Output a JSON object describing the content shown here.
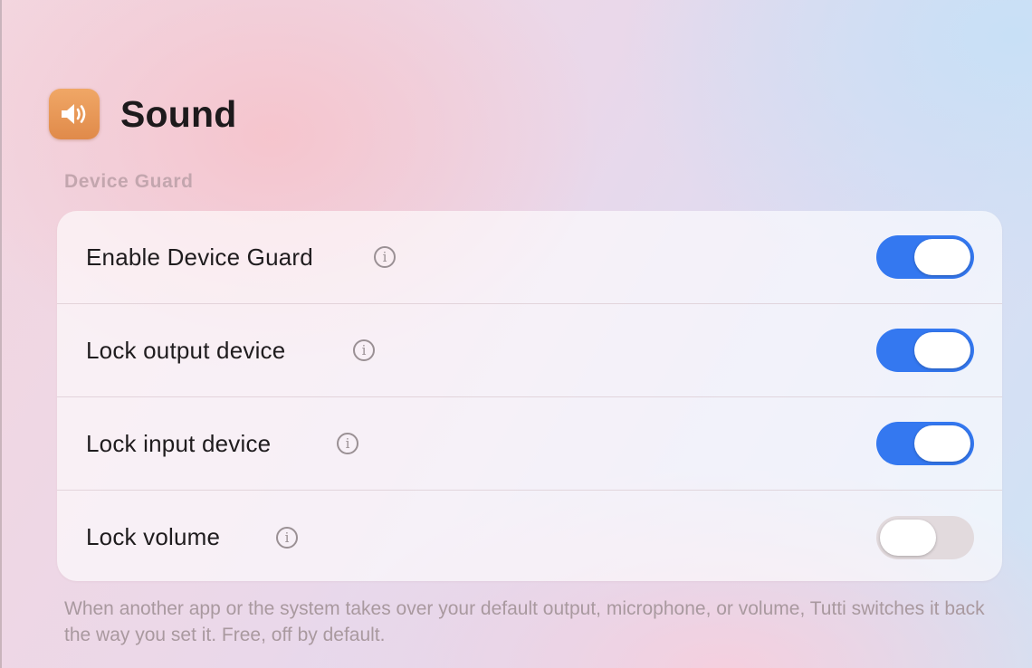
{
  "header": {
    "title": "Sound",
    "icon": "speaker-icon",
    "icon_color": "#E8944F"
  },
  "section": {
    "label": "Device Guard"
  },
  "settings": [
    {
      "label": "Enable Device Guard",
      "info_icon": "info-icon",
      "enabled": true
    },
    {
      "label": "Lock output device",
      "info_icon": "info-icon",
      "enabled": true
    },
    {
      "label": "Lock input device",
      "info_icon": "info-icon",
      "enabled": true
    },
    {
      "label": "Lock volume",
      "info_icon": "info-icon",
      "enabled": false
    }
  ],
  "footer": {
    "note": "When another app or the system takes over your default output, microphone, or volume, Tutti switches it back the way you set it. Free, off by default."
  },
  "colors": {
    "toggle_on": "#3478F0",
    "toggle_off": "#E2DADD",
    "section_label": "#C3A6AE"
  }
}
